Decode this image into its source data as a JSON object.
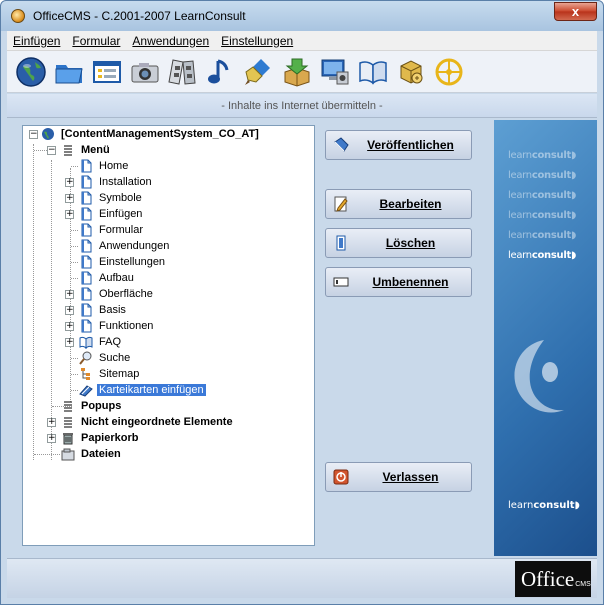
{
  "window": {
    "title": "OfficeCMS - C.2001-2007 LearnConsult",
    "close_glyph": "x"
  },
  "menu": [
    {
      "label": "Einfügen"
    },
    {
      "label": "Formular"
    },
    {
      "label": "Anwendungen"
    },
    {
      "label": "Einstellungen"
    }
  ],
  "toolbar": [
    {
      "icon": "globe-icon"
    },
    {
      "icon": "folder-icon"
    },
    {
      "icon": "form-icon"
    },
    {
      "icon": "camera-icon"
    },
    {
      "icon": "film-icon"
    },
    {
      "icon": "music-note-icon"
    },
    {
      "icon": "brush-icon"
    },
    {
      "icon": "download-box-icon"
    },
    {
      "icon": "monitor-icon"
    },
    {
      "icon": "book-icon"
    },
    {
      "icon": "cube-icon"
    },
    {
      "icon": "compass-icon"
    }
  ],
  "status": {
    "text": "- Inhalte ins Internet übermitteln -"
  },
  "tree": {
    "root": "[ContentManagementSystem_CO_AT]",
    "menu_label": "Menü",
    "menu_items": [
      "Home",
      "Installation",
      "Symbole",
      "Einfügen",
      "Formular",
      "Anwendungen",
      "Einstellungen",
      "Aufbau",
      "Oberfläche",
      "Basis",
      "Funktionen",
      "FAQ",
      "Suche",
      "Sitemap",
      "Karteikarten einfügen"
    ],
    "popups": "Popups",
    "unsorted": "Nicht eingeordnete Elemente",
    "trash": "Papierkorb",
    "files": "Dateien"
  },
  "actions": {
    "publish": "Veröffentlichen",
    "edit": "Bearbeiten",
    "delete": "Löschen",
    "rename": "Umbenennen",
    "exit": "Verlassen"
  },
  "brand": {
    "word1": "learn",
    "word2": "consult"
  },
  "footer": {
    "logo_main": "Office",
    "logo_sub": "CMS"
  },
  "colors": {
    "selection": "#3b79d8",
    "brand_panel": "#2f6fae",
    "close": "#c9452a"
  }
}
